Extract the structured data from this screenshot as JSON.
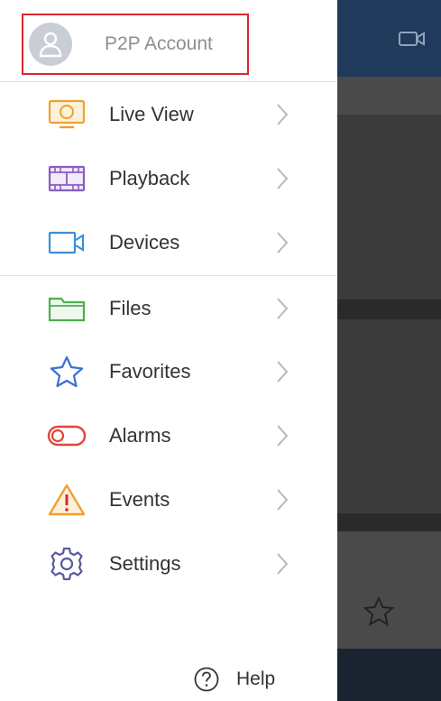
{
  "account": {
    "label": "P2P Account",
    "icon": "user-avatar-icon"
  },
  "menu": [
    {
      "id": "live-view",
      "label": "Live View",
      "icon": "monitor-icon",
      "color": "#f0a030"
    },
    {
      "id": "playback",
      "label": "Playback",
      "icon": "film-icon",
      "color": "#8a5cc0"
    },
    {
      "id": "devices",
      "label": "Devices",
      "icon": "camera-icon",
      "color": "#3b8fd8"
    },
    {
      "id": "files",
      "label": "Files",
      "icon": "folder-icon",
      "color": "#4caf50"
    },
    {
      "id": "favorites",
      "label": "Favorites",
      "icon": "star-icon",
      "color": "#3b6fd8"
    },
    {
      "id": "alarms",
      "label": "Alarms",
      "icon": "toggle-icon",
      "color": "#e0463a"
    },
    {
      "id": "events",
      "label": "Events",
      "icon": "warning-icon",
      "color": "#f0a030"
    },
    {
      "id": "settings",
      "label": "Settings",
      "icon": "gear-icon",
      "color": "#5a5a9a"
    }
  ],
  "help": {
    "label": "Help",
    "icon": "question-icon"
  },
  "colors": {
    "accent_red": "#d9272e",
    "header_blue": "#1f3a5a"
  }
}
